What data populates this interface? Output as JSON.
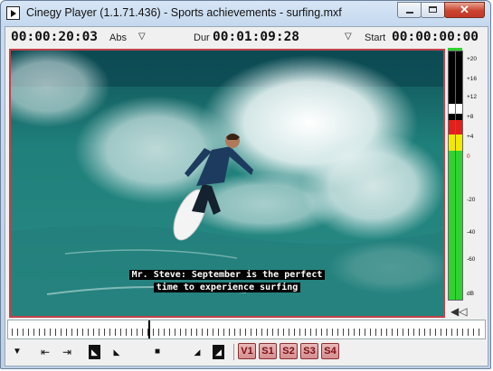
{
  "window": {
    "title": "Cinegy Player (1.1.71.436) - Sports achievements - surfing.mxf",
    "minimize_icon": "minimize-icon",
    "maximize_icon": "maximize-icon",
    "close_icon": "close-icon",
    "close_glyph": "✕"
  },
  "timecode_bar": {
    "current": "00:00:20:03",
    "mode_label": "Abs",
    "duration_label": "Dur",
    "duration": "00:01:09:28",
    "start_label": "Start",
    "start": "00:00:00:00",
    "dropdown_glyph": "▽"
  },
  "video": {
    "subtitle_line1": "Mr. Steve: September is the perfect",
    "subtitle_line2": "time to experience surfing"
  },
  "audio_meter": {
    "scale": [
      "+20",
      "+16",
      "+12",
      "+8",
      "+4",
      "0",
      "-20",
      "-40",
      "-60",
      "dB"
    ],
    "level_db": 0,
    "colors": {
      "green": "#2fd22f",
      "yellow": "#f2e800",
      "red": "#e3201b",
      "peak": "#2fd22f"
    }
  },
  "controls": {
    "menu_glyph": "▼",
    "go_start_glyph": "⇤",
    "go_end_glyph": "⇥",
    "mark_in_glyph": "◣",
    "mark_out_glyph": "◢",
    "stop_glyph": "■",
    "tracks": [
      "V1",
      "S1",
      "S2",
      "S3",
      "S4"
    ]
  }
}
